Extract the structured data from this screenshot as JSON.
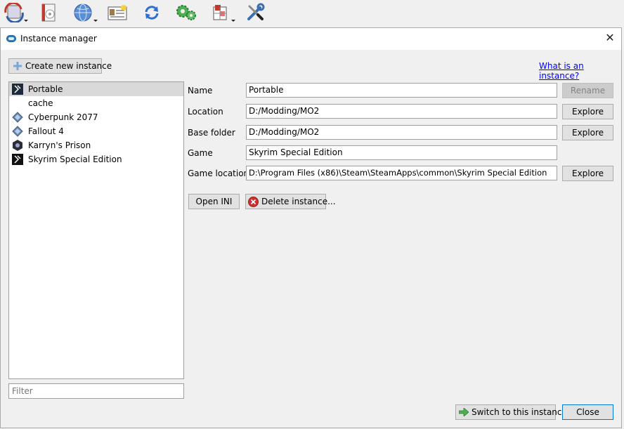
{
  "toolbar": {
    "items": [
      {
        "icon": "profiles-icon"
      },
      {
        "icon": "executables-icon"
      },
      {
        "icon": "nexus-globe-icon"
      },
      {
        "icon": "instance-card-icon"
      },
      {
        "icon": "refresh-icon"
      },
      {
        "icon": "settings-gears-icon"
      },
      {
        "icon": "puzzle-tools-icon"
      },
      {
        "icon": "wrench-screwdriver-icon"
      }
    ]
  },
  "dialog": {
    "title": "Instance manager",
    "create_button": "Create new instance",
    "help_link": "What is an instance?",
    "instances": [
      {
        "name": "Portable",
        "icon": "skyrim-icon",
        "selected": true
      },
      {
        "name": "cache",
        "icon": "",
        "selected": false
      },
      {
        "name": "Cyberpunk 2077",
        "icon": "generic-game-icon",
        "selected": false
      },
      {
        "name": "Fallout 4",
        "icon": "generic-game-icon",
        "selected": false
      },
      {
        "name": "Karryn's Prison",
        "icon": "karryn-icon",
        "selected": false
      },
      {
        "name": "Skyrim Special Edition",
        "icon": "skyrim-icon",
        "selected": false
      }
    ],
    "filter_placeholder": "Filter",
    "details": {
      "name_label": "Name",
      "name_value": "Portable",
      "rename_button": "Rename",
      "location_label": "Location",
      "location_value": "D:/Modding/MO2",
      "location_explore": "Explore",
      "base_label": "Base folder",
      "base_value": "D:/Modding/MO2",
      "base_explore": "Explore",
      "game_label": "Game",
      "game_value": "Skyrim Special Edition",
      "game_location_label": "Game location",
      "game_location_value": "D:\\Program Files (x86)\\Steam\\SteamApps\\common\\Skyrim Special Edition",
      "game_location_explore": "Explore"
    },
    "open_ini_button": "Open INI",
    "delete_button": "Delete instance...",
    "switch_button": "Switch to this instance",
    "close_button": "Close"
  }
}
